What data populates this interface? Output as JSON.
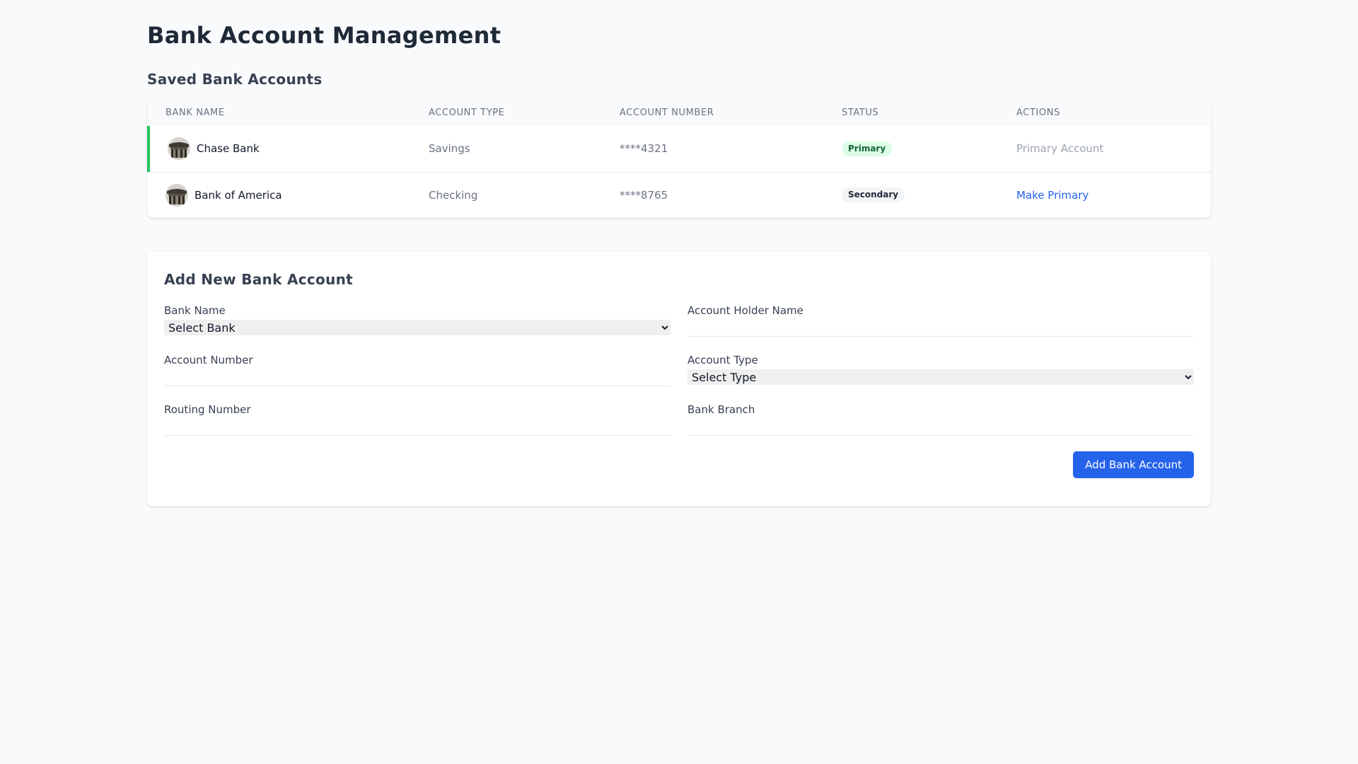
{
  "page": {
    "title": "Bank Account Management"
  },
  "saved": {
    "title": "Saved Bank Accounts",
    "columns": [
      "BANK NAME",
      "ACCOUNT TYPE",
      "ACCOUNT NUMBER",
      "STATUS",
      "ACTIONS"
    ],
    "rows": [
      {
        "bank_name": "Chase Bank",
        "logo_icon": "bank-building-icon",
        "account_type": "Savings",
        "account_number": "****4321",
        "status": "Primary",
        "action": "Primary Account"
      },
      {
        "bank_name": "Bank of America",
        "logo_icon": "bank-building-icon",
        "account_type": "Checking",
        "account_number": "****8765",
        "status": "Secondary",
        "action": "Make Primary"
      }
    ]
  },
  "form": {
    "title": "Add New Bank Account",
    "bank_name": {
      "label": "Bank Name",
      "selected": "Select Bank"
    },
    "holder_name": {
      "label": "Account Holder Name",
      "value": ""
    },
    "account_number": {
      "label": "Account Number",
      "value": ""
    },
    "account_type": {
      "label": "Account Type",
      "selected": "Select Type"
    },
    "routing_number": {
      "label": "Routing Number",
      "value": ""
    },
    "bank_branch": {
      "label": "Bank Branch",
      "value": ""
    },
    "submit_label": "Add Bank Account"
  },
  "colors": {
    "accent": "#2563eb",
    "primary_marker": "#22c55e",
    "primary_badge_bg": "#dcfce7",
    "primary_badge_text": "#166534",
    "page_bg": "#f8fafc"
  }
}
